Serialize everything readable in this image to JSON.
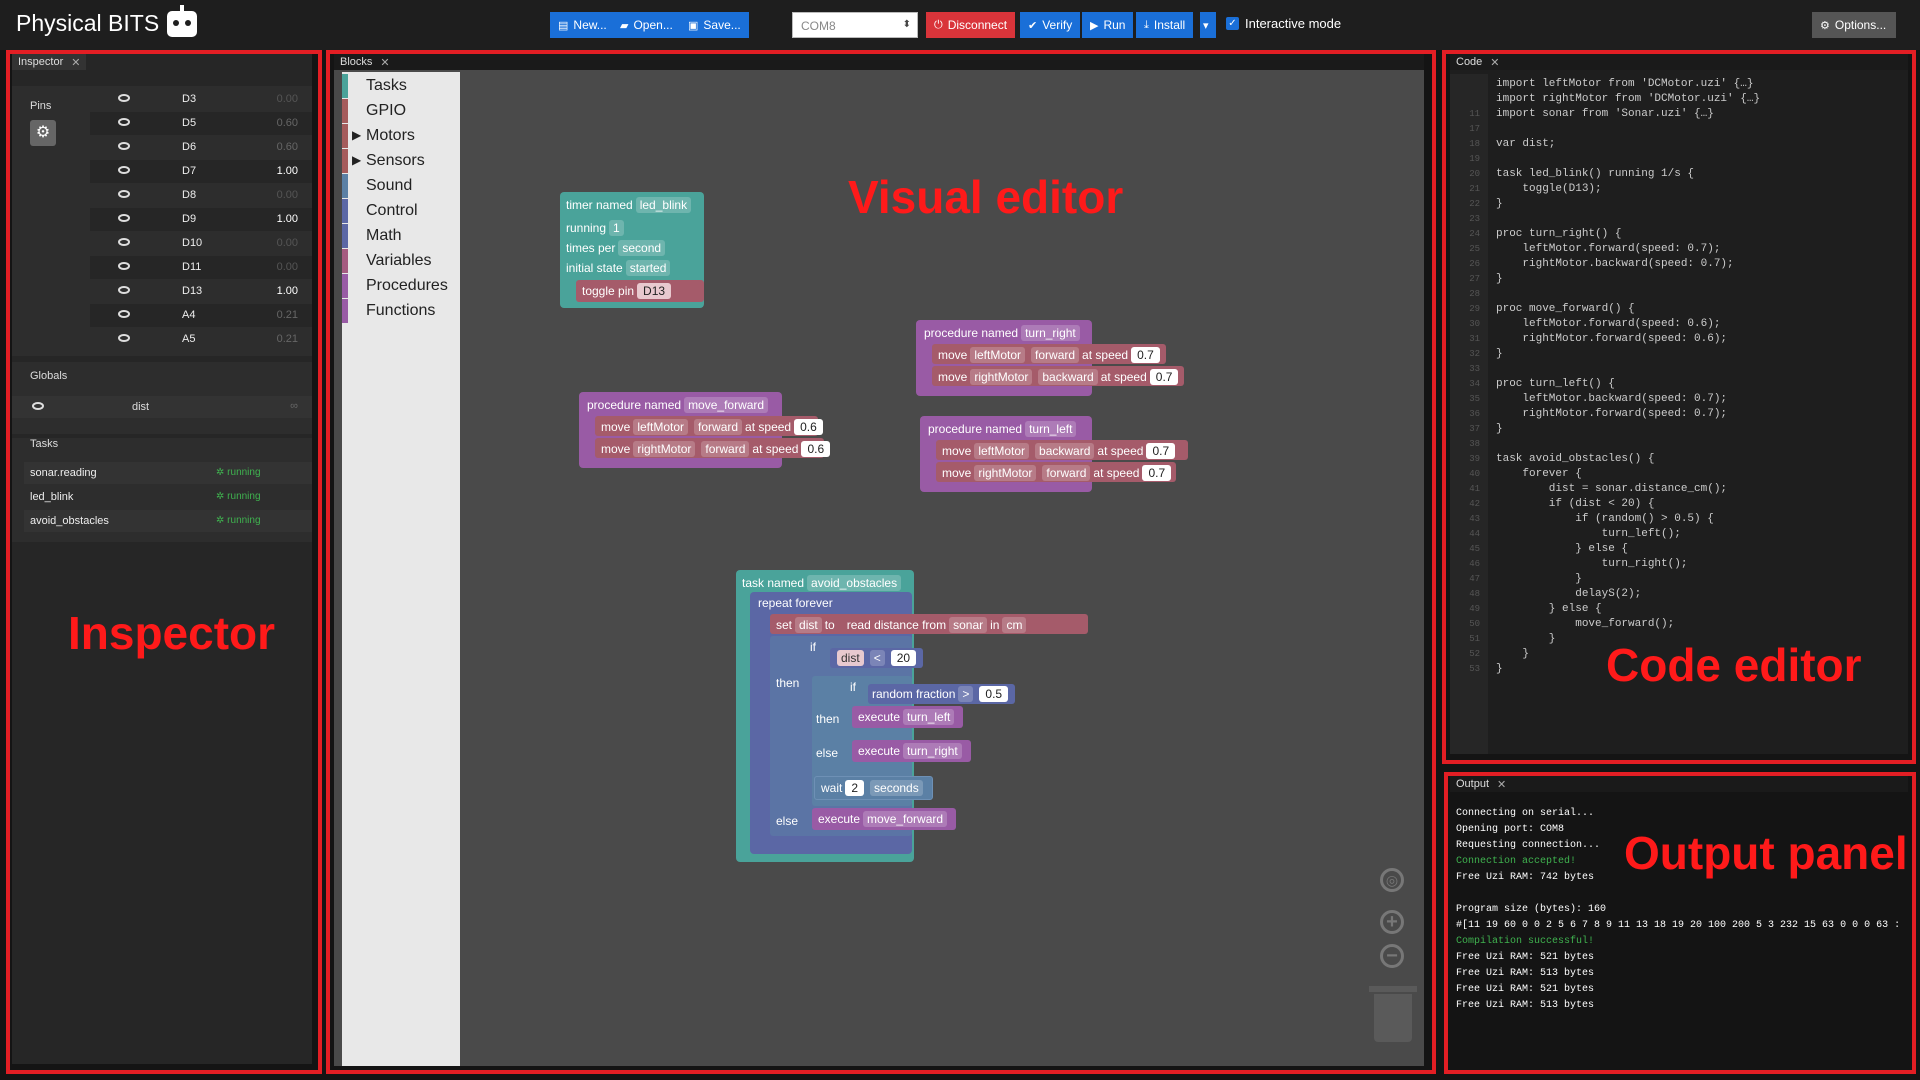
{
  "app": {
    "title": "Physical BITS"
  },
  "toolbar": {
    "new": "New...",
    "open": "Open...",
    "save": "Save...",
    "port": "COM8",
    "disconnect": "Disconnect",
    "verify": "Verify",
    "run": "Run",
    "install": "Install",
    "interactive": "Interactive mode",
    "options": "Options..."
  },
  "inspector": {
    "tab": "Inspector",
    "pins_label": "Pins",
    "pins": [
      {
        "name": "D3",
        "value": "0.00"
      },
      {
        "name": "D5",
        "value": "0.60"
      },
      {
        "name": "D6",
        "value": "0.60"
      },
      {
        "name": "D7",
        "value": "1.00"
      },
      {
        "name": "D8",
        "value": "0.00"
      },
      {
        "name": "D9",
        "value": "1.00"
      },
      {
        "name": "D10",
        "value": "0.00"
      },
      {
        "name": "D11",
        "value": "0.00"
      },
      {
        "name": "D13",
        "value": "1.00"
      },
      {
        "name": "A4",
        "value": "0.21"
      },
      {
        "name": "A5",
        "value": "0.21"
      }
    ],
    "globals_label": "Globals",
    "global_name": "dist",
    "global_value": "∞",
    "tasks_label": "Tasks",
    "tasks": [
      {
        "name": "sonar.reading",
        "state": "running"
      },
      {
        "name": "led_blink",
        "state": "running"
      },
      {
        "name": "avoid_obstacles",
        "state": "running"
      }
    ]
  },
  "blocks": {
    "tab": "Blocks",
    "categories": [
      {
        "label": "Tasks",
        "color": "#4aa39a"
      },
      {
        "label": "GPIO",
        "color": "#a55b5b"
      },
      {
        "label": "Motors",
        "color": "#a55b5b"
      },
      {
        "label": "Sensors",
        "color": "#a55b5b"
      },
      {
        "label": "Sound",
        "color": "#5b80a5"
      },
      {
        "label": "Control",
        "color": "#5b67a5"
      },
      {
        "label": "Math",
        "color": "#5b67a5"
      },
      {
        "label": "Variables",
        "color": "#a55b80"
      },
      {
        "label": "Procedures",
        "color": "#995ba5"
      },
      {
        "label": "Functions",
        "color": "#995ba5"
      }
    ],
    "timer": {
      "head": "timer named",
      "name": "led_blink",
      "running": "running",
      "running_val": "1",
      "times_per": "times per",
      "unit": "second",
      "initial": "initial state",
      "initial_val": "started",
      "toggle": "toggle pin",
      "pin": "D13"
    },
    "proc_move_forward": {
      "head": "procedure named",
      "name": "move_forward",
      "move": "move",
      "m1": "leftMotor",
      "d1": "forward",
      "at": "at speed",
      "s1": "0.6",
      "m2": "rightMotor",
      "d2": "forward",
      "s2": "0.6"
    },
    "proc_turn_right": {
      "head": "procedure named",
      "name": "turn_right",
      "move": "move",
      "m1": "leftMotor",
      "d1": "forward",
      "at": "at speed",
      "s1": "0.7",
      "m2": "rightMotor",
      "d2": "backward",
      "s2": "0.7"
    },
    "proc_turn_left": {
      "head": "procedure named",
      "name": "turn_left",
      "move": "move",
      "m1": "leftMotor",
      "d1": "backward",
      "at": "at speed",
      "s1": "0.7",
      "m2": "rightMotor",
      "d2": "forward",
      "s2": "0.7"
    },
    "task": {
      "head": "task named",
      "name": "avoid_obstacles",
      "repeat": "repeat forever",
      "set": "set",
      "var": "dist",
      "to": "to",
      "read": "read distance from",
      "sensor": "sonar",
      "in": "in",
      "unit": "cm",
      "if": "if",
      "then": "then",
      "else": "else",
      "op": "<",
      "num": "20",
      "random": "random fraction",
      "op2": ">",
      "num2": "0.5",
      "execute": "execute",
      "p1": "turn_left",
      "p2": "turn_right",
      "p3": "move_forward",
      "wait": "wait",
      "wait_val": "2",
      "wait_unit": "seconds"
    }
  },
  "code": {
    "tab": "Code",
    "lines": [
      {
        "n": "",
        "t": "import leftMotor from 'DCMotor.uzi' {…}"
      },
      {
        "n": "",
        "t": "import rightMotor from 'DCMotor.uzi' {…}"
      },
      {
        "n": "11",
        "t": "import sonar from 'Sonar.uzi' {…}"
      },
      {
        "n": "17",
        "t": ""
      },
      {
        "n": "18",
        "t": "var dist;"
      },
      {
        "n": "19",
        "t": ""
      },
      {
        "n": "20",
        "t": "task led_blink() running 1/s {"
      },
      {
        "n": "21",
        "t": "    toggle(D13);"
      },
      {
        "n": "22",
        "t": "}"
      },
      {
        "n": "23",
        "t": ""
      },
      {
        "n": "24",
        "t": "proc turn_right() {"
      },
      {
        "n": "25",
        "t": "    leftMotor.forward(speed: 0.7);"
      },
      {
        "n": "26",
        "t": "    rightMotor.backward(speed: 0.7);"
      },
      {
        "n": "27",
        "t": "}"
      },
      {
        "n": "28",
        "t": ""
      },
      {
        "n": "29",
        "t": "proc move_forward() {"
      },
      {
        "n": "30",
        "t": "    leftMotor.forward(speed: 0.6);"
      },
      {
        "n": "31",
        "t": "    rightMotor.forward(speed: 0.6);"
      },
      {
        "n": "32",
        "t": "}"
      },
      {
        "n": "33",
        "t": ""
      },
      {
        "n": "34",
        "t": "proc turn_left() {"
      },
      {
        "n": "35",
        "t": "    leftMotor.backward(speed: 0.7);"
      },
      {
        "n": "36",
        "t": "    rightMotor.forward(speed: 0.7);"
      },
      {
        "n": "37",
        "t": "}"
      },
      {
        "n": "38",
        "t": ""
      },
      {
        "n": "39",
        "t": "task avoid_obstacles() {"
      },
      {
        "n": "40",
        "t": "    forever {"
      },
      {
        "n": "41",
        "t": "        dist = sonar.distance_cm();"
      },
      {
        "n": "42",
        "t": "        if (dist < 20) {"
      },
      {
        "n": "43",
        "t": "            if (random() > 0.5) {"
      },
      {
        "n": "44",
        "t": "                turn_left();"
      },
      {
        "n": "45",
        "t": "            } else {"
      },
      {
        "n": "46",
        "t": "                turn_right();"
      },
      {
        "n": "47",
        "t": "            }"
      },
      {
        "n": "48",
        "t": "            delayS(2);"
      },
      {
        "n": "49",
        "t": "        } else {"
      },
      {
        "n": "50",
        "t": "            move_forward();"
      },
      {
        "n": "51",
        "t": "        }"
      },
      {
        "n": "52",
        "t": "    }"
      },
      {
        "n": "53",
        "t": "}"
      }
    ]
  },
  "output": {
    "tab": "Output",
    "lines": [
      {
        "t": "Connecting on serial...",
        "ok": false
      },
      {
        "t": "Opening port: COM8",
        "ok": false
      },
      {
        "t": "Requesting connection...",
        "ok": false
      },
      {
        "t": "Connection accepted!",
        "ok": true
      },
      {
        "t": "Free Uzi RAM: 742 bytes",
        "ok": false
      },
      {
        "t": "",
        "ok": false
      },
      {
        "t": "Program size (bytes): 160",
        "ok": false
      },
      {
        "t": "#[11 19 60 0 0 2 5 6 7 8 9 11 13 18 19 20 100 200 5 3 232 15 63 0 0 0 63 :",
        "ok": false
      },
      {
        "t": "Compilation successful!",
        "ok": true
      },
      {
        "t": "Free Uzi RAM: 521 bytes",
        "ok": false
      },
      {
        "t": "Free Uzi RAM: 513 bytes",
        "ok": false
      },
      {
        "t": "Free Uzi RAM: 521 bytes",
        "ok": false
      },
      {
        "t": "Free Uzi RAM: 513 bytes",
        "ok": false
      }
    ]
  },
  "annotations": {
    "inspector": "Inspector",
    "visual": "Visual editor",
    "code": "Code editor",
    "output": "Output panel"
  }
}
